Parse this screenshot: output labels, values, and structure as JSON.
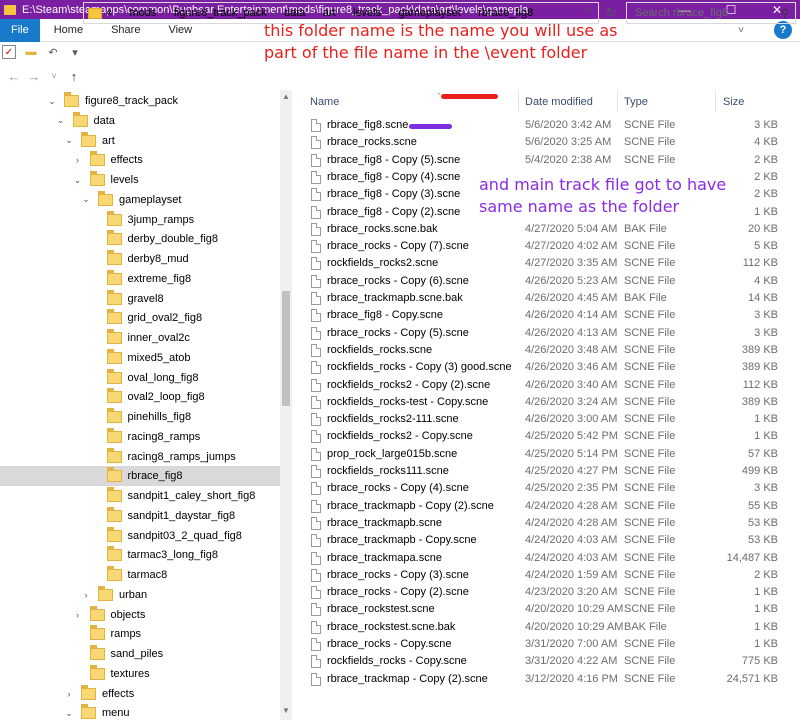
{
  "window": {
    "title": "E:\\Steam\\steamapps\\common\\Bugbear Entertainment\\mods\\figure8_track_pack\\data\\art\\levels\\gamepla",
    "minimize": "—",
    "maximize": "☐",
    "close": "✕"
  },
  "ribbon": {
    "tabs": [
      "File",
      "Home",
      "Share",
      "View"
    ],
    "expand": "˅",
    "help": "?"
  },
  "address": {
    "overflow": "«",
    "crumbs": [
      "mods",
      "figure8_track_pack",
      "data",
      "art",
      "levels",
      "gameplayset",
      "rbrace_fig8"
    ],
    "dropdown": "˅"
  },
  "search": {
    "placeholder": "Search rbrace_fig8"
  },
  "nav_tree": [
    {
      "label": "figure8_track_pack",
      "chev": "⌄"
    },
    {
      "label": "data",
      "chev": "⌄"
    },
    {
      "label": "art",
      "chev": "⌄"
    },
    {
      "label": "effects",
      "chev": "›"
    },
    {
      "label": "levels",
      "chev": "⌄"
    },
    {
      "label": "gameplayset",
      "chev": "⌄"
    },
    {
      "label": "3jump_ramps",
      "chev": ""
    },
    {
      "label": "derby_double_fig8",
      "chev": ""
    },
    {
      "label": "derby8_mud",
      "chev": ""
    },
    {
      "label": "extreme_fig8",
      "chev": ""
    },
    {
      "label": "gravel8",
      "chev": ""
    },
    {
      "label": "grid_oval2_fig8",
      "chev": ""
    },
    {
      "label": "inner_oval2c",
      "chev": ""
    },
    {
      "label": "mixed5_atob",
      "chev": ""
    },
    {
      "label": "oval_long_fig8",
      "chev": ""
    },
    {
      "label": "oval2_loop_fig8",
      "chev": ""
    },
    {
      "label": "pinehills_fig8",
      "chev": ""
    },
    {
      "label": "racing8_ramps",
      "chev": ""
    },
    {
      "label": "racing8_ramps_jumps",
      "chev": ""
    },
    {
      "label": "rbrace_fig8",
      "chev": "",
      "selected": true
    },
    {
      "label": "sandpit1_caley_short_fig8",
      "chev": ""
    },
    {
      "label": "sandpit1_daystar_fig8",
      "chev": ""
    },
    {
      "label": "sandpit03_2_quad_fig8",
      "chev": ""
    },
    {
      "label": "tarmac3_long_fig8",
      "chev": ""
    },
    {
      "label": "tarmac8",
      "chev": ""
    },
    {
      "label": "urban",
      "chev": "›"
    },
    {
      "label": "objects",
      "chev": "›"
    },
    {
      "label": "ramps",
      "chev": ""
    },
    {
      "label": "sand_piles",
      "chev": ""
    },
    {
      "label": "textures",
      "chev": ""
    },
    {
      "label": "effects",
      "chev": "›"
    },
    {
      "label": "menu",
      "chev": "⌄"
    }
  ],
  "columns": {
    "name": "Name",
    "date": "Date modified",
    "type": "Type",
    "size": "Size"
  },
  "files": [
    {
      "name": "rbrace_fig8.scne",
      "date": "5/6/2020 3:42 AM",
      "type": "SCNE File",
      "size": "3 KB"
    },
    {
      "name": "rbrace_rocks.scne",
      "date": "5/6/2020 3:25 AM",
      "type": "SCNE File",
      "size": "4 KB"
    },
    {
      "name": "rbrace_fig8 - Copy (5).scne",
      "date": "5/4/2020 2:38 AM",
      "type": "SCNE File",
      "size": "2 KB"
    },
    {
      "name": "rbrace_fig8 - Copy (4).scne",
      "date": "",
      "type": "",
      "size": "2 KB"
    },
    {
      "name": "rbrace_fig8 - Copy (3).scne",
      "date": "",
      "type": "",
      "size": "2 KB"
    },
    {
      "name": "rbrace_fig8 - Copy (2).scne",
      "date": "",
      "type": "",
      "size": "1 KB"
    },
    {
      "name": "rbrace_rocks.scne.bak",
      "date": "4/27/2020 5:04 AM",
      "type": "BAK File",
      "size": "20 KB"
    },
    {
      "name": "rbrace_rocks - Copy (7).scne",
      "date": "4/27/2020 4:02 AM",
      "type": "SCNE File",
      "size": "5 KB"
    },
    {
      "name": "rockfields_rocks2.scne",
      "date": "4/27/2020 3:35 AM",
      "type": "SCNE File",
      "size": "112 KB"
    },
    {
      "name": "rbrace_rocks - Copy (6).scne",
      "date": "4/26/2020 5:23 AM",
      "type": "SCNE File",
      "size": "4 KB"
    },
    {
      "name": "rbrace_trackmapb.scne.bak",
      "date": "4/26/2020 4:45 AM",
      "type": "BAK File",
      "size": "14 KB"
    },
    {
      "name": "rbrace_fig8 - Copy.scne",
      "date": "4/26/2020 4:14 AM",
      "type": "SCNE File",
      "size": "3 KB"
    },
    {
      "name": "rbrace_rocks - Copy (5).scne",
      "date": "4/26/2020 4:13 AM",
      "type": "SCNE File",
      "size": "3 KB"
    },
    {
      "name": "rockfields_rocks.scne",
      "date": "4/26/2020 3:48 AM",
      "type": "SCNE File",
      "size": "389 KB"
    },
    {
      "name": "rockfields_rocks - Copy (3) good.scne",
      "date": "4/26/2020 3:46 AM",
      "type": "SCNE File",
      "size": "389 KB"
    },
    {
      "name": "rockfields_rocks2 - Copy (2).scne",
      "date": "4/26/2020 3:40 AM",
      "type": "SCNE File",
      "size": "112 KB"
    },
    {
      "name": "rockfields_rocks-test - Copy.scne",
      "date": "4/26/2020 3:24 AM",
      "type": "SCNE File",
      "size": "389 KB"
    },
    {
      "name": "rockfields_rocks2-111.scne",
      "date": "4/26/2020 3:00 AM",
      "type": "SCNE File",
      "size": "1 KB"
    },
    {
      "name": "rockfields_rocks2 - Copy.scne",
      "date": "4/25/2020 5:42 PM",
      "type": "SCNE File",
      "size": "1 KB"
    },
    {
      "name": "prop_rock_large015b.scne",
      "date": "4/25/2020 5:14 PM",
      "type": "SCNE File",
      "size": "57 KB"
    },
    {
      "name": "rockfields_rocks111.scne",
      "date": "4/25/2020 4:27 PM",
      "type": "SCNE File",
      "size": "499 KB"
    },
    {
      "name": "rbrace_rocks - Copy (4).scne",
      "date": "4/25/2020 2:35 PM",
      "type": "SCNE File",
      "size": "3 KB"
    },
    {
      "name": "rbrace_trackmapb - Copy (2).scne",
      "date": "4/24/2020 4:28 AM",
      "type": "SCNE File",
      "size": "55 KB"
    },
    {
      "name": "rbrace_trackmapb.scne",
      "date": "4/24/2020 4:28 AM",
      "type": "SCNE File",
      "size": "53 KB"
    },
    {
      "name": "rbrace_trackmapb - Copy.scne",
      "date": "4/24/2020 4:03 AM",
      "type": "SCNE File",
      "size": "53 KB"
    },
    {
      "name": "rbrace_trackmapa.scne",
      "date": "4/24/2020 4:03 AM",
      "type": "SCNE File",
      "size": "14,487 KB"
    },
    {
      "name": "rbrace_rocks - Copy (3).scne",
      "date": "4/24/2020 1:59 AM",
      "type": "SCNE File",
      "size": "2 KB"
    },
    {
      "name": "rbrace_rocks - Copy (2).scne",
      "date": "4/23/2020 3:20 AM",
      "type": "SCNE File",
      "size": "1 KB"
    },
    {
      "name": "rbrace_rockstest.scne",
      "date": "4/20/2020 10:29 AM",
      "type": "SCNE File",
      "size": "1 KB"
    },
    {
      "name": "rbrace_rockstest.scne.bak",
      "date": "4/20/2020 10:29 AM",
      "type": "BAK File",
      "size": "1 KB"
    },
    {
      "name": "rbrace_rocks - Copy.scne",
      "date": "3/31/2020 7:00 AM",
      "type": "SCNE File",
      "size": "1 KB"
    },
    {
      "name": "rockfields_rocks - Copy.scne",
      "date": "3/31/2020 4:22 AM",
      "type": "SCNE File",
      "size": "775 KB"
    },
    {
      "name": "rbrace_trackmap - Copy (2).scne",
      "date": "3/12/2020 4:16 PM",
      "type": "SCNE File",
      "size": "24,571 KB"
    }
  ],
  "annotations": {
    "red_line1": "this folder name is the name you will use as",
    "red_line2": "part of the file name in the \\event folder",
    "purple_line1": "and main track file got to have",
    "purple_line2": "same name as the folder"
  },
  "colors": {
    "titlebar": "#7a1fa2",
    "accent": "#1979ca",
    "annotation_red": "#e8201c",
    "annotation_purple": "#8a2be2"
  }
}
